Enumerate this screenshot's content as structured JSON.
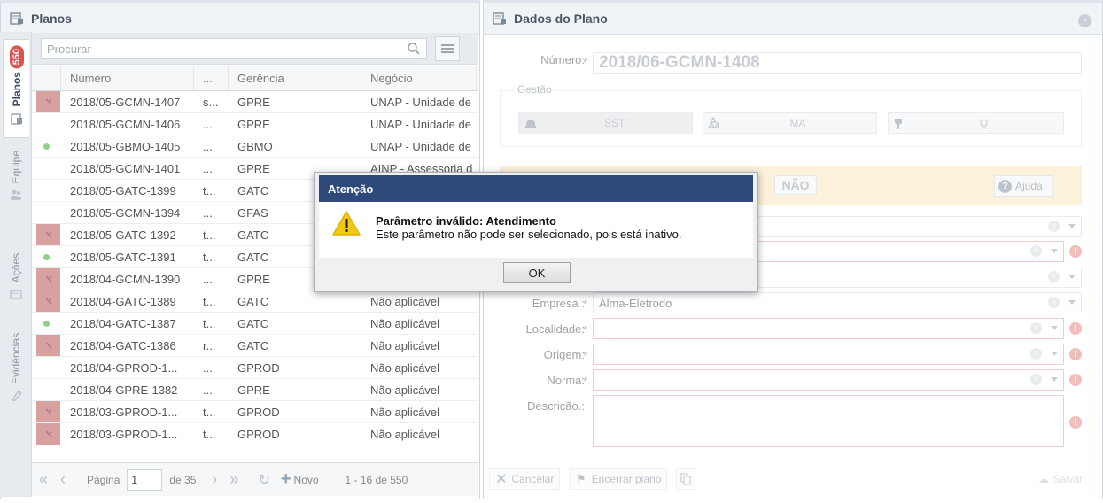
{
  "left_panel": {
    "title": "Planos",
    "side_tabs": [
      {
        "label": "Planos",
        "badge": "550"
      },
      {
        "label": "Equipe"
      },
      {
        "label": "Ações"
      },
      {
        "label": "Evidências"
      }
    ],
    "search_placeholder": "Procurar",
    "columns": [
      "Número",
      "...",
      "Gerência",
      "Negócio"
    ],
    "rows": [
      {
        "status": "red",
        "numero": "2018/05-GCMN-1407",
        "dots": "s...",
        "gerencia": "GPRE",
        "negocio": "UNAP - Unidade de"
      },
      {
        "status": "none",
        "numero": "2018/05-GCMN-1406",
        "dots": "...",
        "gerencia": "GPRE",
        "negocio": "UNAP - Unidade de"
      },
      {
        "status": "green",
        "numero": "2018/05-GBMO-1405",
        "dots": "...",
        "gerencia": "GBMO",
        "negocio": "UNAP - Unidade de"
      },
      {
        "status": "none",
        "numero": "2018/05-GCMN-1401",
        "dots": "...",
        "gerencia": "GPRE",
        "negocio": "AINP - Assessoria d"
      },
      {
        "status": "none",
        "numero": "2018/05-GATC-1399",
        "dots": "t...",
        "gerencia": "GATC",
        "negocio": ""
      },
      {
        "status": "none",
        "numero": "2018/05-GCMN-1394",
        "dots": "...",
        "gerencia": "GFAS",
        "negocio": ""
      },
      {
        "status": "red",
        "numero": "2018/05-GATC-1392",
        "dots": "t...",
        "gerencia": "GATC",
        "negocio": ""
      },
      {
        "status": "green",
        "numero": "2018/05-GATC-1391",
        "dots": "t...",
        "gerencia": "GATC",
        "negocio": ""
      },
      {
        "status": "red",
        "numero": "2018/04-GCMN-1390",
        "dots": "...",
        "gerencia": "GPRE",
        "negocio": ""
      },
      {
        "status": "red",
        "numero": "2018/04-GATC-1389",
        "dots": "t...",
        "gerencia": "GATC",
        "negocio": "Não aplicável"
      },
      {
        "status": "green",
        "numero": "2018/04-GATC-1387",
        "dots": "t...",
        "gerencia": "GATC",
        "negocio": "Não aplicável"
      },
      {
        "status": "red",
        "numero": "2018/04-GATC-1386",
        "dots": "r...",
        "gerencia": "GATC",
        "negocio": "Não aplicável"
      },
      {
        "status": "none",
        "numero": "2018/04-GPROD-1...",
        "dots": "...",
        "gerencia": "GPROD",
        "negocio": "Não aplicável"
      },
      {
        "status": "none",
        "numero": "2018/04-GPRE-1382",
        "dots": "...",
        "gerencia": "GPRE",
        "negocio": "Não aplicável"
      },
      {
        "status": "red",
        "numero": "2018/03-GPROD-1...",
        "dots": "t...",
        "gerencia": "GPROD",
        "negocio": "Não aplicável"
      },
      {
        "status": "red",
        "numero": "2018/03-GPROD-1...",
        "dots": "t...",
        "gerencia": "GPROD",
        "negocio": "Não aplicável"
      }
    ],
    "pager": {
      "page_label": "Página",
      "page_value": "1",
      "of_label": "de 35",
      "new_label": "Novo",
      "range": "1 - 16 de 550"
    }
  },
  "right_panel": {
    "title": "Dados do Plano",
    "numero_label": "Número:",
    "numero_value": "2018/06-GCMN-1408",
    "gestao_legend": "Gestão",
    "gestao_buttons": [
      "SST",
      "MA",
      "Q"
    ],
    "nao_label": "NÃO",
    "help_label": "Ajuda",
    "empresa_label": "Empresa :",
    "empresa_value": "Alma-Eletrodo",
    "localidade_label": "Localidade:",
    "origem_label": "Origem:",
    "norma_label": "Norma:",
    "descricao_label": "Descrição.:",
    "cancel_label": "Cancelar",
    "close_plan_label": "Encerrar plano",
    "save_label": "Salvar"
  },
  "modal": {
    "title": "Atenção",
    "message_title": "Parâmetro inválido: Atendimento",
    "message_body": "Este parâmetro não pode ser selecionado, pois está inativo.",
    "ok_label": "OK"
  },
  "colors": {
    "modal_title_bg": "#2e4a7b",
    "badge": "#d9534f",
    "warning_bar": "#fbe7bf",
    "required": "#d9534f"
  }
}
